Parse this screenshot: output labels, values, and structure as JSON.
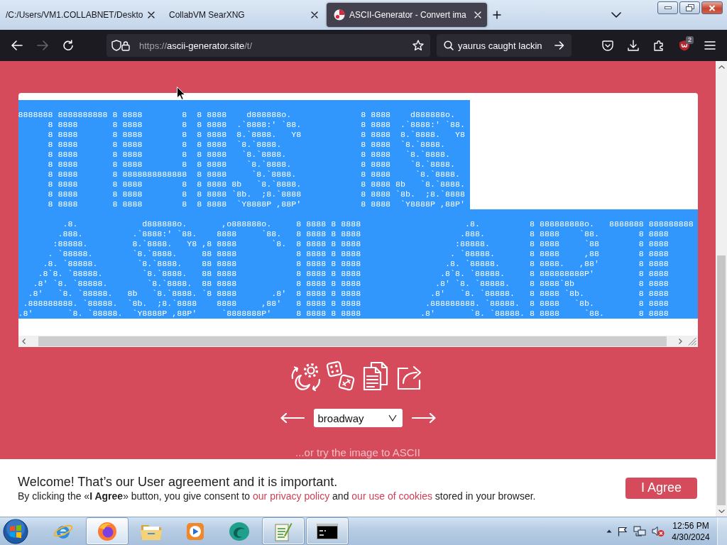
{
  "browser": {
    "tabs": [
      {
        "title": "/C:/Users/VM1.COLLABNET/Deskto",
        "favicon": false,
        "selected": false
      },
      {
        "title": "CollabVM SearXNG",
        "favicon": false,
        "selected": false
      },
      {
        "title": "ASCII-Generator - Convert ima",
        "favicon": true,
        "selected": true
      }
    ],
    "nav_buttons": [
      {
        "disabled": false
      },
      {
        "disabled": true
      },
      {
        "disabled": false
      }
    ],
    "address": {
      "scheme": "https://",
      "host": "ascii-generator.site",
      "path": "/t/"
    },
    "search": {
      "value": "yaurus caught lackin"
    },
    "extension_badge": "2"
  },
  "page": {
    "ascii_output": {
      "blocks": [
        {
          "selected": true,
          "lines": [
            "8888888 8888888888 8 8888        8  8 8888    d888888o.              8 8888    d888888o.",
            "      8 8888       8 8888        8  8 8888  .`8888:' `88.            8 8888  .`8888:' `88.",
            "      8 8888       8 8888        8  8 8888  8.`8888.   Y8            8 8888  8.`8888.   Y8",
            "      8 8888       8 8888        8  8 8888  `8.`8888.                8 8888  `8.`8888.",
            "      8 8888       8 8888        8  8 8888   `8.`8888.               8 8888   `8.`8888.",
            "      8 8888       8 8888        8  8 8888    `8.`8888.              8 8888    `8.`8888.",
            "      8 8888       8 8888888888888  8 8888     `8.`8888.             8 8888     `8.`8888.",
            "      8 8888       8 8888        8  8 8888 8b   `8.`8888.            8 8888 8b   `8.`8888.",
            "      8 8888       8 8888        8  8 8888 `8b.  ;8.`8888            8 8888 `8b.  ;8.`8888",
            "      8 8888       8 8888        8  8 8888  `Y8888P ,88P'            8 8888  `Y8888P ,88P'"
          ]
        },
        {
          "selected": true,
          "lines": [
            "         .8.             d888888o.       ,o888888o.     8 8888 8 8888                     .8.          8 888888888o.   8888888 888888888",
            "        .888.          .`8888:' `88.    8888     `88.   8 8888 8 8888                    .888.         8 8888    `88.        8 8888",
            "       :88888.         8.`8888.   Y8 ,8 8888       `8.  8 8888 8 8888                   :88888.        8 8888     `88        8 8888",
            "      . `88888.        `8.`8888.     88 8888            8 8888 8 8888                  . `88888.       8 8888     ,88        8 8888",
            "     .8. `88888.        `8.`8888.    88 8888            8 8888 8 8888                 .8. `88888.      8 8888.   ,88'        8 8888",
            "    .8`8. `88888.        `8.`8888.   88 8888            8 8888 8 8888                .8`8. `88888.     8 888888888P'         8 8888",
            "   .8' `8. `88888.        `8.`8888.  88 8888            8 8888 8 8888               .8' `8. `88888.    8 8888`8b             8 8888",
            "  .8'   `8. `88888.   8b   `8.`8888. `8 8888       .8'  8 8888 8 8888              .8'   `8. `88888.   8 8888 `8b.           8 8888",
            " .888888888. `88888.  `8b.  ;8.`8888    8888     ,88'   8 8888 8 8888             .888888888. `88888.  8 8888   `8b.         8 8888",
            ".8'       `8. `88888.  `Y8888P ,88P'     `8888888P'     8 8888 8 8888            .8'       `8. `88888. 8 8888     `88.       8 8888"
          ]
        }
      ]
    },
    "font_select": {
      "value": "broadway"
    },
    "image_link": "...or try the image to ASCII"
  },
  "cookie_banner": {
    "title": "Welcome! That’s our User agreement and it is important.",
    "message": [
      {
        "kind": "text",
        "text": "By clicking the «**I Agree**» button, you give consent to "
      },
      {
        "kind": "link",
        "text": "our privacy policy"
      },
      {
        "kind": "text",
        "text": " and "
      },
      {
        "kind": "link",
        "text": "our use of cookies"
      },
      {
        "kind": "text",
        "text": " stored in your browser."
      }
    ],
    "button": "I Agree"
  },
  "taskbar": {
    "apps": [
      {
        "running": false,
        "selected": false
      },
      {
        "running": true,
        "selected": true
      },
      {
        "running": false,
        "selected": false
      },
      {
        "running": false,
        "selected": false
      },
      {
        "running": false,
        "selected": false
      },
      {
        "running": true,
        "selected": false
      },
      {
        "running": true,
        "selected": false
      }
    ],
    "clock": {
      "time": "12:56 PM",
      "date": "4/30/2024"
    }
  }
}
